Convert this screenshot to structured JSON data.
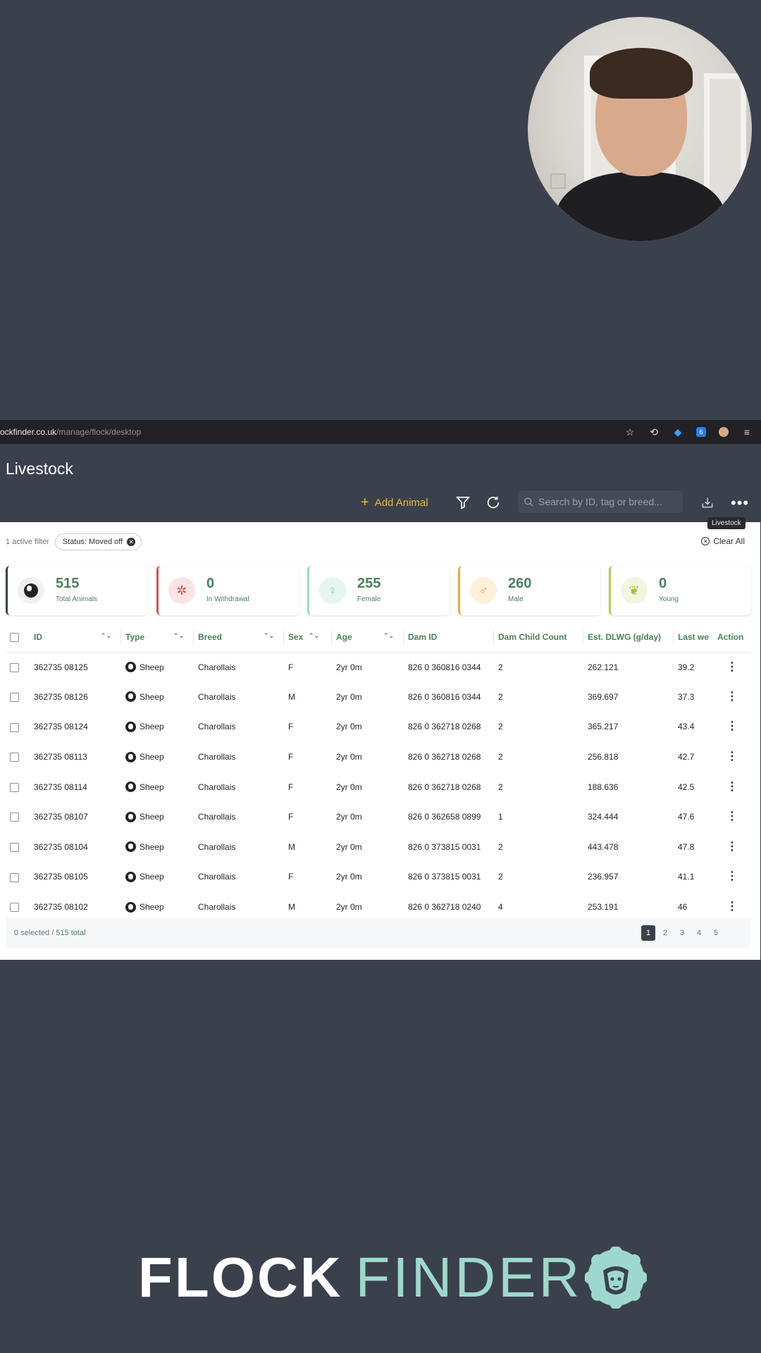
{
  "browser": {
    "url_domain": "ockfinder.co.uk",
    "url_path": "/manage/flock/desktop",
    "ext_badge": "6"
  },
  "header": {
    "title": "Livestock",
    "add_label": "Add Animal",
    "search_placeholder": "Search by ID, tag or breed...",
    "tooltip": "Livestock"
  },
  "filters": {
    "active_count": "1 active filter",
    "chip_label": "Status: Moved off",
    "clear_all": "Clear All"
  },
  "stats": [
    {
      "value": "515",
      "label": "Total Animals",
      "color": "#3b414c"
    },
    {
      "value": "0",
      "label": "In Withdrawal",
      "color": "#d9534f"
    },
    {
      "value": "255",
      "label": "Female",
      "color": "#9ed8cc"
    },
    {
      "value": "260",
      "label": "Male",
      "color": "#e8a93a"
    },
    {
      "value": "0",
      "label": "Young",
      "color": "#b5cf4a"
    }
  ],
  "table": {
    "columns": [
      "ID",
      "Type",
      "Breed",
      "Sex",
      "Age",
      "Dam ID",
      "Dam Child Count",
      "Est. DLWG (g/day)",
      "Last we",
      "Action"
    ],
    "rows": [
      {
        "id": "362735 08125",
        "type": "Sheep",
        "breed": "Charollais",
        "sex": "F",
        "age": "2yr 0m",
        "dam": "826 0 360816 0344",
        "count": "2",
        "dlwg": "262.121",
        "last": "39.2"
      },
      {
        "id": "362735 08126",
        "type": "Sheep",
        "breed": "Charollais",
        "sex": "M",
        "age": "2yr 0m",
        "dam": "826 0 360816 0344",
        "count": "2",
        "dlwg": "369.697",
        "last": "37.3"
      },
      {
        "id": "362735 08124",
        "type": "Sheep",
        "breed": "Charollais",
        "sex": "F",
        "age": "2yr 0m",
        "dam": "826 0 362718 0268",
        "count": "2",
        "dlwg": "365.217",
        "last": "43.4"
      },
      {
        "id": "362735 08113",
        "type": "Sheep",
        "breed": "Charollais",
        "sex": "F",
        "age": "2yr 0m",
        "dam": "826 0 362718 0268",
        "count": "2",
        "dlwg": "256.818",
        "last": "42.7"
      },
      {
        "id": "362735 08114",
        "type": "Sheep",
        "breed": "Charollais",
        "sex": "F",
        "age": "2yr 0m",
        "dam": "826 0 362718 0268",
        "count": "2",
        "dlwg": "188.636",
        "last": "42.5"
      },
      {
        "id": "362735 08107",
        "type": "Sheep",
        "breed": "Charollais",
        "sex": "F",
        "age": "2yr 0m",
        "dam": "826 0 362658 0899",
        "count": "1",
        "dlwg": "324.444",
        "last": "47.6"
      },
      {
        "id": "362735 08104",
        "type": "Sheep",
        "breed": "Charollais",
        "sex": "M",
        "age": "2yr 0m",
        "dam": "826 0 373815 0031",
        "count": "2",
        "dlwg": "443.478",
        "last": "47.8"
      },
      {
        "id": "362735 08105",
        "type": "Sheep",
        "breed": "Charollais",
        "sex": "F",
        "age": "2yr 0m",
        "dam": "826 0 373815 0031",
        "count": "2",
        "dlwg": "236.957",
        "last": "41.1"
      },
      {
        "id": "362735 08102",
        "type": "Sheep",
        "breed": "Charollais",
        "sex": "M",
        "age": "2yr 0m",
        "dam": "826 0 362718 0240",
        "count": "4",
        "dlwg": "253.191",
        "last": "46"
      }
    ]
  },
  "footer": {
    "selected": "0 selected / ",
    "total": "515 total",
    "pages": [
      "1",
      "2",
      "3",
      "4",
      "5"
    ]
  },
  "logo": {
    "part1": "FLOCK",
    "part2": "FINDER"
  }
}
